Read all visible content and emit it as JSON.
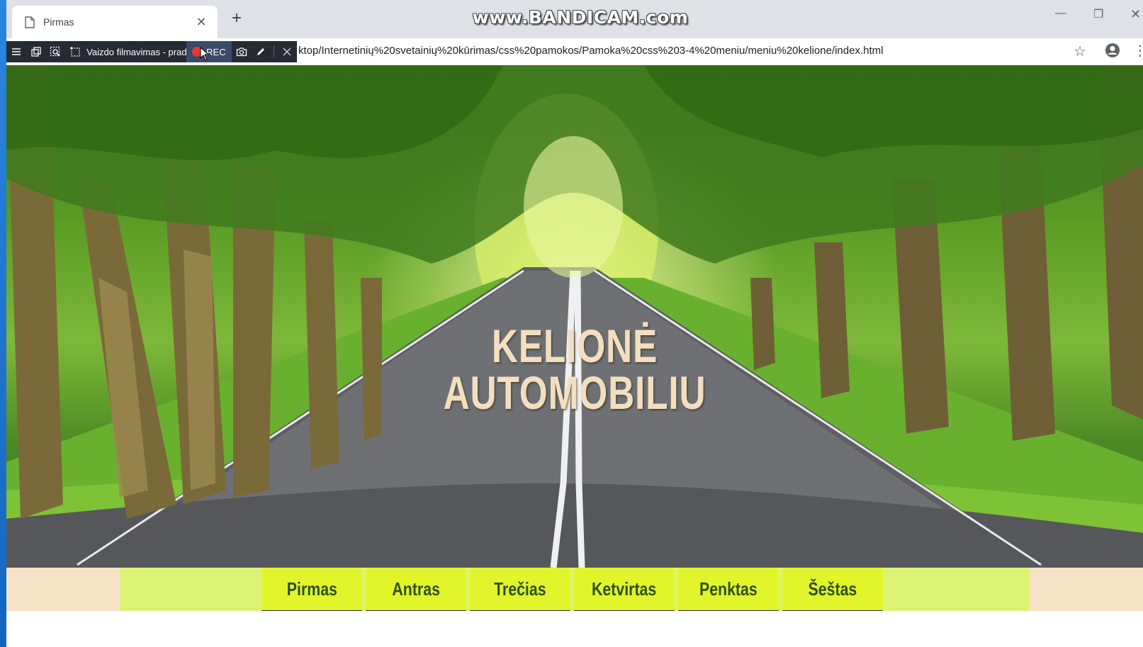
{
  "recorder": {
    "watermark": "www.BANDICAM.com",
    "title": "Vaizdo filmavimas - prad",
    "rec_label": "REC"
  },
  "browser": {
    "tab_title": "Pirmas",
    "new_tab": "+",
    "url": "file:///C:/Users/Desktop/Internetinių%20svetainių%20kūrimas/css%20pamokos/Pamoka%20css%203-4%20meniu/meniu%20kelione/index.html",
    "url_visible": "ktop/Internetinių%20svetainių%20kūrimas/css%20pamokos/Pamoka%20css%203-4%20meniu/meniu%20kelione/index.html"
  },
  "hero": {
    "title_line1": "KELIONĖ",
    "title_line2": "AUTOMOBILIU"
  },
  "menu": {
    "items": [
      "Pirmas",
      "Antras",
      "Trečias",
      "Ketvirtas",
      "Penktas",
      "Šeštas"
    ]
  },
  "colors": {
    "nav_outer": "#f6e2c6",
    "nav_inner": "#dcf274",
    "menu_item": "#e2f52a",
    "title_text": "#f3dfc0"
  }
}
